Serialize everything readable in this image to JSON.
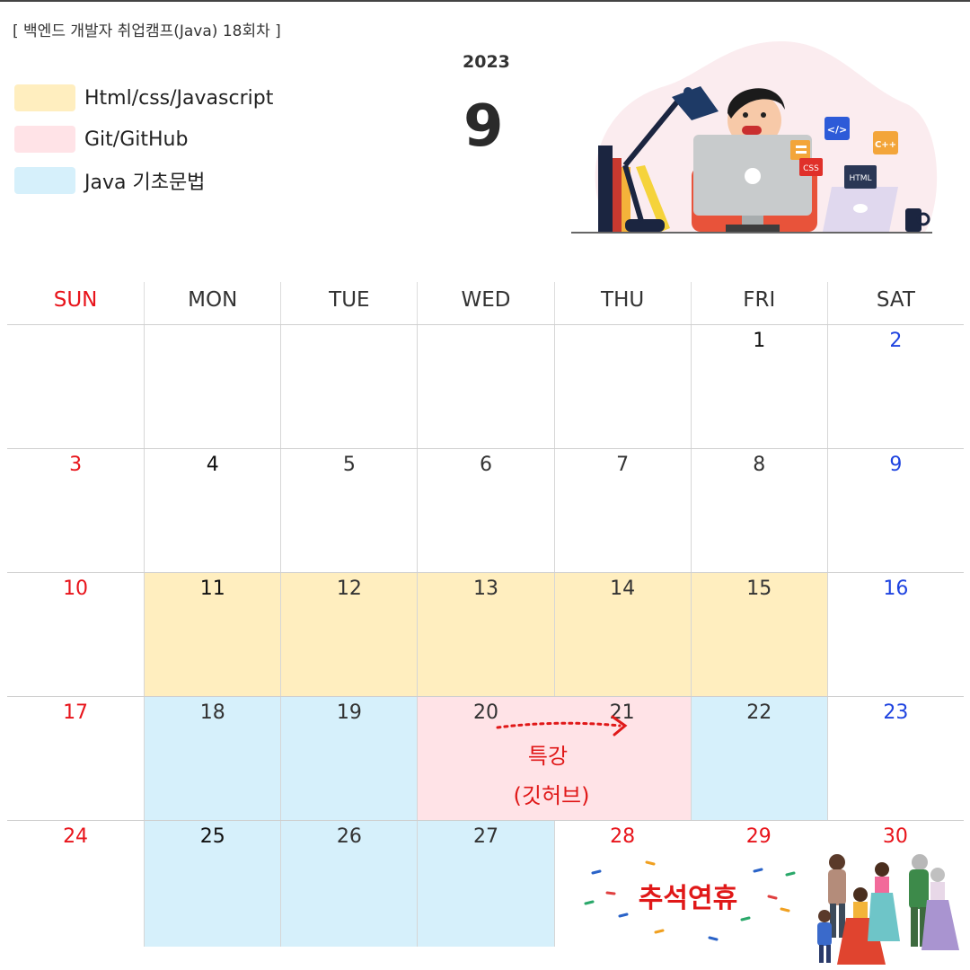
{
  "header": {
    "camp_title": "[ 백엔드 개발자 취업캠프(Java) 18회차 ]",
    "year": "2023",
    "month": "9"
  },
  "legend": [
    {
      "label": "Html/css/Javascript",
      "color": "#ffeebf"
    },
    {
      "label": "Git/GitHub",
      "color": "#ffe3e7"
    },
    {
      "label": "Java 기초문법",
      "color": "#d6f0fb"
    }
  ],
  "illustration": {
    "icon_labels": [
      "</>",
      "C++",
      "CSS",
      "HTML"
    ]
  },
  "calendar": {
    "weekdays": [
      "SUN",
      "MON",
      "TUE",
      "WED",
      "THU",
      "FRI",
      "SAT"
    ],
    "weeks": [
      [
        "",
        "",
        "",
        "",
        "",
        "1",
        "2"
      ],
      [
        "3",
        "4",
        "5",
        "6",
        "7",
        "8",
        "9"
      ],
      [
        "10",
        "11",
        "12",
        "13",
        "14",
        "15",
        "16"
      ],
      [
        "17",
        "18",
        "19",
        "20",
        "21",
        "22",
        "23"
      ],
      [
        "24",
        "25",
        "26",
        "27",
        "28",
        "29",
        "30"
      ]
    ]
  },
  "annotations": {
    "special_lecture_line1": "특강",
    "special_lecture_line2": "(깃허브)",
    "holiday": "추석연휴"
  }
}
